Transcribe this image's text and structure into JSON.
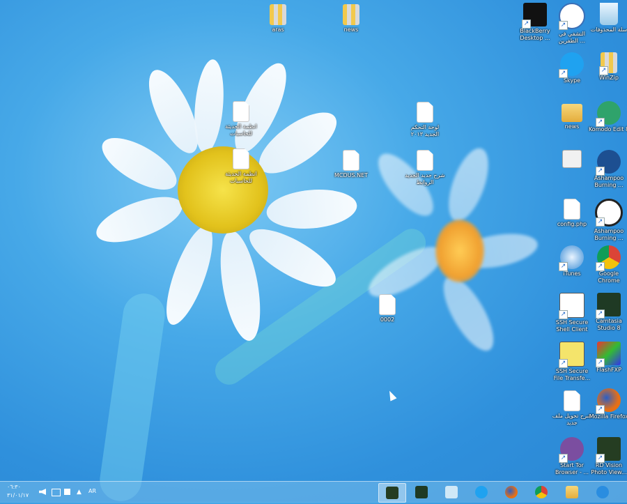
{
  "desktop": {
    "icons": [
      {
        "name": "recycle-bin",
        "label": "سلة المحذوفات"
      },
      {
        "name": "blackberry",
        "label": "BlackBerry Desktop ..."
      },
      {
        "name": "arabic-shortcut",
        "label": "التشفي في الطفرين ..."
      },
      {
        "name": "skype",
        "label": "Skype"
      },
      {
        "name": "winzip",
        "label": "WinZip"
      },
      {
        "name": "news-folder",
        "label": "news"
      },
      {
        "name": "komodo",
        "label": "Komodo Edit 8"
      },
      {
        "name": "text-file",
        "label": ""
      },
      {
        "name": "ashampoo-1",
        "label": "Ashampoo Burning ..."
      },
      {
        "name": "config-php",
        "label": "config.php"
      },
      {
        "name": "ashampoo-2",
        "label": "Ashampoo Burning ..."
      },
      {
        "name": "itunes",
        "label": "iTunes"
      },
      {
        "name": "chrome",
        "label": "Google Chrome"
      },
      {
        "name": "ssh-client",
        "label": "SSH Secure Shell Client"
      },
      {
        "name": "camtasia",
        "label": "Camtasia Studio 8"
      },
      {
        "name": "ssh-transfer",
        "label": "SSH Secure File Transfe..."
      },
      {
        "name": "flashfxp",
        "label": "FlashFXP"
      },
      {
        "name": "doc-1",
        "label": "شرح تحويل ملف جديد"
      },
      {
        "name": "firefox",
        "label": "Mozilla Firefox"
      },
      {
        "name": "tor",
        "label": "Start Tor Browser - ..."
      },
      {
        "name": "rdvision",
        "label": "RD Vision Photo View..."
      },
      {
        "name": "aras",
        "label": "aras"
      },
      {
        "name": "news-zip",
        "label": "news"
      },
      {
        "name": "doc-arabic-1",
        "label": "انظمة الحديثة للحاسبات"
      },
      {
        "name": "doc-arabic-2",
        "label": "انظمة الحديثة للحاسبات"
      },
      {
        "name": "mcdus",
        "label": "MCDUS.NET"
      },
      {
        "name": "doc-arabic-3",
        "label": "لوحة التحكم الجديد ٢٠١٣"
      },
      {
        "name": "doc-arabic-4",
        "label": "شرح جديد الجديد الروابط"
      },
      {
        "name": "doc-0002",
        "label": "0002"
      }
    ]
  },
  "taskbar": {
    "language": "AR",
    "time": "٠٦:٣٠",
    "date": "٣١/٠١/١٧"
  }
}
